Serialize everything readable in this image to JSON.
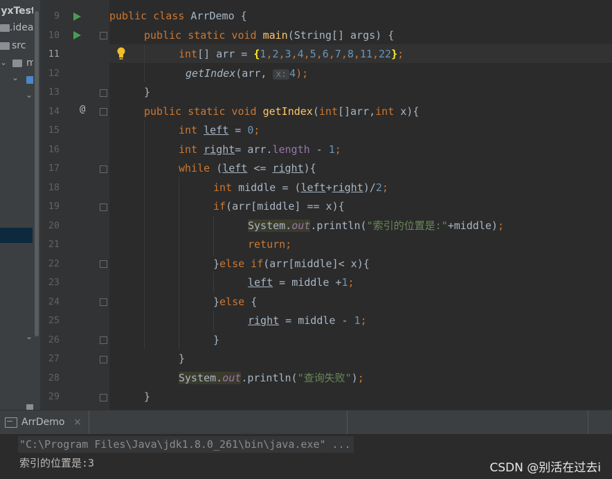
{
  "project": {
    "items": [
      "yxTest",
      "idea",
      "src",
      "ma"
    ]
  },
  "editor": {
    "current_line": 11,
    "line_numbers": [
      "9",
      "10",
      "11",
      "12",
      "13",
      "14",
      "15",
      "16",
      "17",
      "18",
      "19",
      "20",
      "21",
      "22",
      "23",
      "24",
      "25",
      "26",
      "27",
      "28",
      "29"
    ]
  },
  "code": {
    "l9": {
      "a": "public class ",
      "b": "ArrDemo {"
    },
    "l10": {
      "a": "public static void ",
      "b": "main",
      "c": "(String[] args) {"
    },
    "l11": {
      "a": "int",
      "b": "[] arr = ",
      "c": "{",
      "d": "1",
      "e": ",",
      "f": "2",
      "g": ",",
      "h": "3",
      "i": ",",
      "j": "4",
      "k": ",",
      "l": "5",
      "m": ",",
      "n": "6",
      "o": ",",
      "p": "7",
      "q": ",",
      "r": "8",
      "s": ",",
      "t": "11",
      "u": ",",
      "v": "22",
      "w": "}",
      "x": ";"
    },
    "l12": {
      "a": "getIndex",
      "b": "(arr, ",
      "hint": "x:",
      "c": "4",
      "d": ");"
    },
    "l13": {
      "a": "}"
    },
    "l14": {
      "a": "public static void ",
      "b": "getIndex",
      "c": "(",
      "d": "int",
      "e": "[]arr,",
      "f": "int ",
      "g": "x){"
    },
    "l15": {
      "a": "int ",
      "b": "left",
      "c": " = ",
      "d": "0",
      "e": ";"
    },
    "l16": {
      "a": "int ",
      "b": "right",
      "c": "= arr.",
      "d": "length",
      "e": " - ",
      "f": "1",
      "g": ";"
    },
    "l17": {
      "a": "while ",
      "b": "(",
      "c": "left",
      "d": " <= ",
      "e": "right",
      "f": "){"
    },
    "l18": {
      "a": "int ",
      "b": "middle = (",
      "c": "left",
      "d": "+",
      "e": "right",
      "f": ")/",
      "g": "2",
      "h": ";"
    },
    "l19": {
      "a": "if",
      "b": "(arr[middle] == x){"
    },
    "l20": {
      "a": "System.",
      "b": "out",
      "c": ".println(",
      "d": "\"索引的位置是:\"",
      "e": "+middle)",
      "f": ";"
    },
    "l21": {
      "a": "return;"
    },
    "l22": {
      "a": "}",
      "b": "else if",
      "c": "(arr[middle]< x){"
    },
    "l23": {
      "a": "left",
      "b": " = middle +",
      "c": "1",
      "d": ";"
    },
    "l24": {
      "a": "}",
      "b": "else ",
      "c": "{"
    },
    "l25": {
      "a": "right",
      "b": " = middle - ",
      "c": "1",
      "d": ";"
    },
    "l26": {
      "a": "}"
    },
    "l27": {
      "a": "}"
    },
    "l28": {
      "a": "System.",
      "b": "out",
      "c": ".println(",
      "d": "\"查询失败\"",
      "e": ")",
      "f": ";"
    },
    "l29": {
      "a": "}"
    }
  },
  "run_tab": {
    "label": "ArrDemo",
    "close": "×"
  },
  "console": {
    "command": "\"C:\\Program Files\\Java\\jdk1.8.0_261\\bin\\java.exe\" ...",
    "output": "索引的位置是:3"
  },
  "watermark": "CSDN @别活在过去i",
  "colors": {
    "keyword": "#cc7832",
    "method": "#ffc66d",
    "number": "#6897bb",
    "string": "#6a8759",
    "field": "#9876aa",
    "text": "#a9b7c6",
    "run": "#499c54",
    "background": "#2b2b2b"
  }
}
